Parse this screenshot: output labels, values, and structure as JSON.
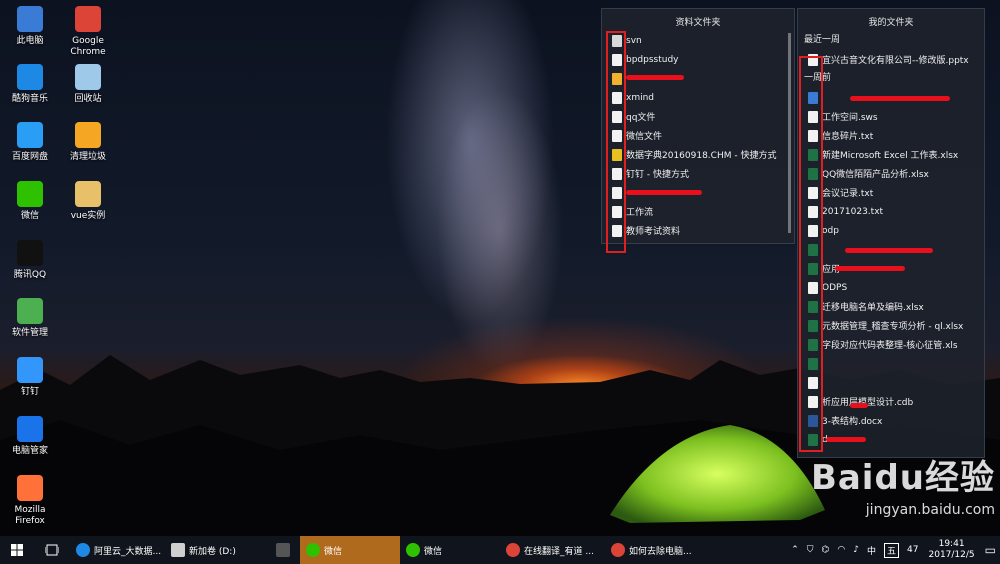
{
  "desktop": {
    "icons": [
      {
        "label": "此电脑",
        "icon": "computer-icon",
        "color": "#3a7bd5"
      },
      {
        "label": "Google Chrome",
        "icon": "chrome-icon",
        "color": "#db4437"
      },
      {
        "label": "酷狗音乐",
        "icon": "kugou-icon",
        "color": "#1e88e5"
      },
      {
        "label": "回收站",
        "icon": "recycle-bin-icon",
        "color": "#9ec9e8"
      },
      {
        "label": "百度网盘",
        "icon": "baidu-netdisk-icon",
        "color": "#2a9df4"
      },
      {
        "label": "清理垃圾",
        "icon": "cleanup-icon",
        "color": "#f5a623"
      },
      {
        "label": "微信",
        "icon": "wechat-icon",
        "color": "#2dc100"
      },
      {
        "label": "vue实例",
        "icon": "folder-zip-icon",
        "color": "#e8c06a"
      },
      {
        "label": "腾讯QQ",
        "icon": "qq-icon",
        "color": "#111111"
      },
      {
        "label": "软件管理",
        "icon": "software-manager-icon",
        "color": "#4caf50"
      },
      {
        "label": "钉钉",
        "icon": "dingtalk-icon",
        "color": "#3296fa"
      },
      {
        "label": "电脑管家",
        "icon": "pc-manager-icon",
        "color": "#1a73e8"
      },
      {
        "label": "Mozilla Firefox",
        "icon": "firefox-icon",
        "color": "#ff7139"
      }
    ]
  },
  "left_panel": {
    "title": "资料文件夹",
    "items": [
      {
        "label": "svn",
        "icon": "file-icon",
        "color": "#d9d9d9"
      },
      {
        "label": "bpdpsstudy",
        "icon": "file-icon",
        "color": "#f2f2f2"
      },
      {
        "label": "",
        "icon": "file-icon",
        "color": "#f0b030"
      },
      {
        "label": "xmind",
        "icon": "file-icon",
        "color": "#f2f2f2"
      },
      {
        "label": "qq文件",
        "icon": "file-icon",
        "color": "#f2f2f2"
      },
      {
        "label": "微信文件",
        "icon": "file-icon",
        "color": "#f2f2f2"
      },
      {
        "label": "数据字典20160918.CHM - 快捷方式",
        "icon": "help-file-icon",
        "color": "#e8c020"
      },
      {
        "label": "钉钉 - 快捷方式",
        "icon": "file-icon",
        "color": "#f2f2f2"
      },
      {
        "label": "",
        "icon": "file-icon",
        "color": "#f2f2f2"
      },
      {
        "label": "工作流",
        "icon": "file-icon",
        "color": "#f2f2f2"
      },
      {
        "label": "教师考试资料",
        "icon": "file-icon",
        "color": "#f2f2f2"
      }
    ]
  },
  "right_panel": {
    "title": "我的文件夹",
    "section_recent_week": "最近一周",
    "recent_items": [
      {
        "label": "宜兴古音文化有限公司--修改版.pptx",
        "icon": "file-icon",
        "color": "#f2f2f2"
      }
    ],
    "section_one_week_ago": "一周前",
    "older_items": [
      {
        "label": "",
        "icon": "rp-file-icon",
        "color": "#3a7bd5"
      },
      {
        "label": "工作空间.sws",
        "icon": "file-icon",
        "color": "#f2f2f2"
      },
      {
        "label": "信息碎片.txt",
        "icon": "text-file-icon",
        "color": "#f2f2f2"
      },
      {
        "label": "新建Microsoft Excel 工作表.xlsx",
        "icon": "excel-icon",
        "color": "#1f7244"
      },
      {
        "label": "QQ微信陌陌产品分析.xlsx",
        "icon": "excel-icon",
        "color": "#1f7244"
      },
      {
        "label": "会议记录.txt",
        "icon": "text-file-icon",
        "color": "#f2f2f2"
      },
      {
        "label": "20171023.txt",
        "icon": "text-file-icon",
        "color": "#f2f2f2"
      },
      {
        "label": "odp",
        "icon": "text-file-icon",
        "color": "#f2f2f2"
      },
      {
        "label": "",
        "icon": "cdm-file-icon",
        "color": "#1f7244"
      },
      {
        "label": "应用",
        "icon": "excel-icon",
        "color": "#1f7244"
      },
      {
        "label": "ODPS",
        "icon": "pdf-icon",
        "color": "#f2f2f2"
      },
      {
        "label": "迁移电脑名单及编码.xlsx",
        "icon": "excel-icon",
        "color": "#1f7244"
      },
      {
        "label": "元数据管理_稽查专项分析 - ql.xlsx",
        "icon": "excel-icon",
        "color": "#1f7244"
      },
      {
        "label": "字段对应代码表整理-核心征管.xls",
        "icon": "excel-icon",
        "color": "#1f7244"
      },
      {
        "label": "",
        "icon": "excel-icon",
        "color": "#1f7244"
      },
      {
        "label": "",
        "icon": "text-file-icon",
        "color": "#f2f2f2"
      },
      {
        "label": "析应用层模型设计.cdb",
        "icon": "file-icon",
        "color": "#f2f2f2"
      },
      {
        "label": "3-表结构.docx",
        "icon": "word-icon",
        "color": "#2b579a"
      },
      {
        "label": "dm",
        "icon": "cdm-file-icon",
        "color": "#1f7244"
      }
    ]
  },
  "taskbar": {
    "items": [
      {
        "label": "阿里云_大数据...",
        "icon": "edge-icon",
        "color": "#1e88e5",
        "active": false
      },
      {
        "label": "新加卷 (D:)",
        "icon": "drive-icon",
        "color": "#cfcfcf",
        "active": false
      },
      {
        "label": "",
        "icon": "calculator-icon",
        "color": "#555555",
        "active": false
      },
      {
        "label": "微信",
        "icon": "wechat-icon",
        "color": "#2dc100",
        "active": true
      },
      {
        "label": "微信",
        "icon": "wechat-icon",
        "color": "#2dc100",
        "active": false
      },
      {
        "label": "在线翻译_有道 ...",
        "icon": "chrome-icon",
        "color": "#db4437",
        "active": false
      },
      {
        "label": "如何去除电脑...",
        "icon": "chrome-icon",
        "color": "#db4437",
        "active": false
      }
    ],
    "tray": {
      "ime": "中",
      "ime2": "五",
      "badge": "47",
      "time": "19:41",
      "date": "2017/12/5"
    }
  },
  "watermark": {
    "brand": "Baidu经验",
    "url": "jingyan.baidu.com"
  }
}
